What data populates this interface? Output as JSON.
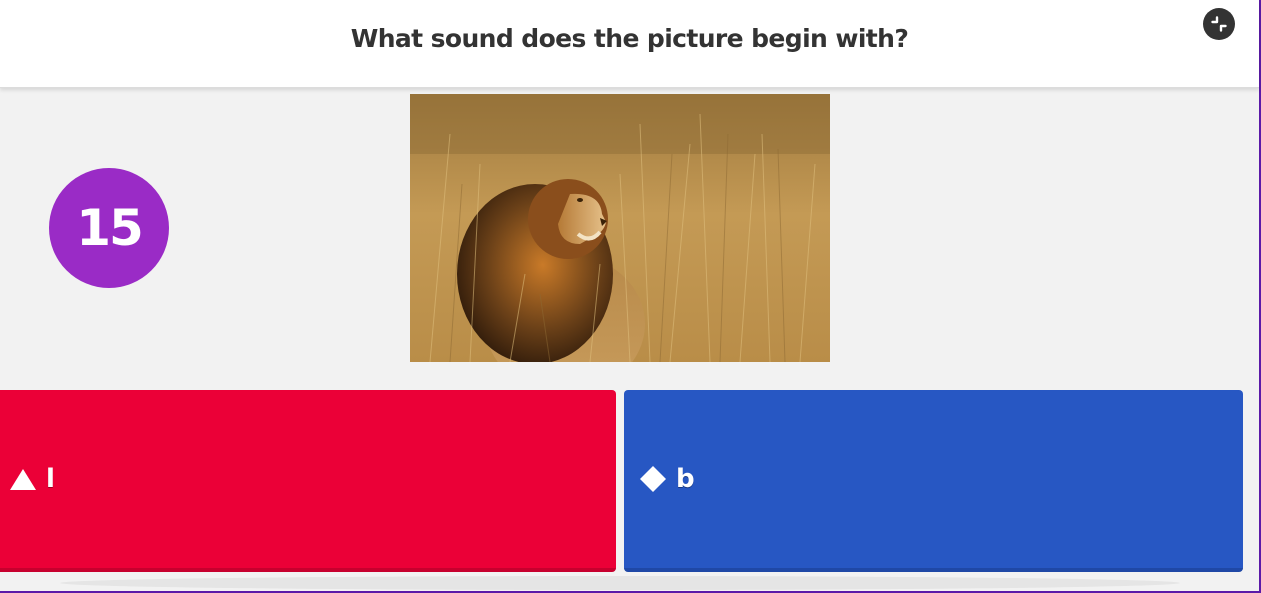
{
  "header": {
    "question": "What sound does the picture begin with?",
    "fullscreen_icon": "exit-fullscreen-icon"
  },
  "timer": {
    "seconds_remaining": "15"
  },
  "question_image": {
    "subject": "lion-in-grass-photo"
  },
  "answers": [
    {
      "shape": "triangle-icon",
      "label": "l",
      "color": "#eb0037"
    },
    {
      "shape": "diamond-icon",
      "label": "b",
      "color": "#2757c3"
    }
  ],
  "colors": {
    "timer": "#9a2bc6",
    "header_text": "#333333",
    "background": "#f2f2f2"
  }
}
